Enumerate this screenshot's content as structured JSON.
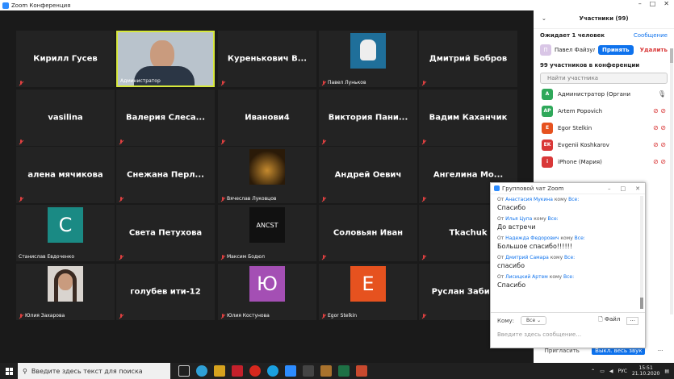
{
  "window": {
    "title": "Zoom Конференция"
  },
  "tiles": [
    {
      "name": "Кирилл Гусев",
      "caption": "",
      "muted": true,
      "kind": "name"
    },
    {
      "name": "",
      "caption": "Администратор",
      "muted": false,
      "kind": "video",
      "active": true
    },
    {
      "name": "Куренькович  В...",
      "caption": "",
      "muted": true,
      "kind": "name"
    },
    {
      "name": "",
      "caption": "Павел Луньков",
      "muted": true,
      "kind": "image",
      "image": "stormtrooper-icon"
    },
    {
      "name": "Дмитрий Бобров",
      "caption": "",
      "muted": true,
      "kind": "name"
    },
    {
      "name": "vasilina",
      "caption": "",
      "muted": true,
      "kind": "name"
    },
    {
      "name": "Валерия  Слеса...",
      "caption": "",
      "muted": true,
      "kind": "name"
    },
    {
      "name": "Иванови4",
      "caption": "",
      "muted": true,
      "kind": "name"
    },
    {
      "name": "Виктория  Пани...",
      "caption": "",
      "muted": true,
      "kind": "name"
    },
    {
      "name": "Вадим Каханчик",
      "caption": "",
      "muted": true,
      "kind": "name"
    },
    {
      "name": "алена мячикова",
      "caption": "",
      "muted": true,
      "kind": "name"
    },
    {
      "name": "Снежана  Перл...",
      "caption": "",
      "muted": true,
      "kind": "name"
    },
    {
      "name": "",
      "caption": "Вячеслав Луковцов",
      "muted": true,
      "kind": "image",
      "image": "candles-icon"
    },
    {
      "name": "Андрей Оевич",
      "caption": "",
      "muted": true,
      "kind": "name"
    },
    {
      "name": "Ангелина Мо...",
      "caption": "",
      "muted": true,
      "kind": "name"
    },
    {
      "name": "",
      "caption": "Станислав Евдоченко",
      "muted": false,
      "kind": "avatar",
      "letter": "С",
      "color": "#1a8a84"
    },
    {
      "name": "Света Петухова",
      "caption": "",
      "muted": true,
      "kind": "name"
    },
    {
      "name": "",
      "caption": "Максим Бодюл",
      "muted": true,
      "kind": "image",
      "image": "ancst-logo",
      "logo_text": "ANCST"
    },
    {
      "name": "Соловьян Иван",
      "caption": "",
      "muted": true,
      "kind": "name"
    },
    {
      "name": "Tkachuk",
      "caption": "",
      "muted": true,
      "kind": "name"
    },
    {
      "name": "",
      "caption": "Юлия Захарова",
      "muted": true,
      "kind": "image",
      "image": "portrait-photo"
    },
    {
      "name": "голубев ити-12",
      "caption": "",
      "muted": true,
      "kind": "name"
    },
    {
      "name": "",
      "caption": "Юлия Костунова",
      "muted": true,
      "kind": "avatar",
      "letter": "Ю",
      "color": "#a44fb4"
    },
    {
      "name": "",
      "caption": "Egor Stelkin",
      "muted": true,
      "kind": "avatar",
      "letter": "E",
      "color": "#e6521f"
    },
    {
      "name": "Руслан Забир...",
      "caption": "",
      "muted": true,
      "kind": "name"
    }
  ],
  "participants": {
    "header": "Участники (99)",
    "waiting_label": "Ожидает 1 человек",
    "message_all": "Сообщение",
    "pending": {
      "initial": "П",
      "name": "Павел Файзул",
      "accept": "Принять",
      "remove": "Удалить"
    },
    "count_label": "99 участников в конференции",
    "search_placeholder": "Найти участника",
    "list": [
      {
        "initials": "A",
        "name": "Администратор (Организатор, я)",
        "color": "#2fa85a"
      },
      {
        "initials": "AP",
        "name": "Artem Popovich",
        "color": "#2fa85a"
      },
      {
        "initials": "E",
        "name": "Egor Stelkin",
        "color": "#e6521f"
      },
      {
        "initials": "EK",
        "name": "Evgenii Koshkarov",
        "color": "#d93838"
      },
      {
        "initials": "i",
        "name": "iPhone (Мария)",
        "color": "#d93838"
      }
    ],
    "invite": "Пригласить",
    "mute_all": "Выкл. весь звук"
  },
  "chat": {
    "title": "Групповой чат Zoom",
    "messages": [
      {
        "from_prefix": "От",
        "from": "Анастасия Мукина",
        "to_prefix": "кому",
        "to": "Все:",
        "text": "Спасибо"
      },
      {
        "from_prefix": "От",
        "from": "Илья Цупа",
        "to_prefix": "кому",
        "to": "Все:",
        "text": "До встречи"
      },
      {
        "from_prefix": "От",
        "from": "Надежда Федорович",
        "to_prefix": "кому",
        "to": "Все:",
        "text": "Большое спасибо!!!!!!"
      },
      {
        "from_prefix": "От",
        "from": "Дмитрий Самара",
        "to_prefix": "кому",
        "to": "Все:",
        "text": "спасибо"
      },
      {
        "from_prefix": "От",
        "from": "Лисицкий Артем",
        "to_prefix": "кому",
        "to": "Все:",
        "text": "Спасибо"
      }
    ],
    "to_label": "Кому:",
    "to_value": "Все",
    "file_label": "Файл",
    "more": "···",
    "input_placeholder": "Введите здесь сообщение..."
  },
  "taskbar": {
    "search_placeholder": "Введите здесь текст для поиска",
    "lang": "РУС",
    "time": "15:51",
    "date": "21.10.2020"
  }
}
